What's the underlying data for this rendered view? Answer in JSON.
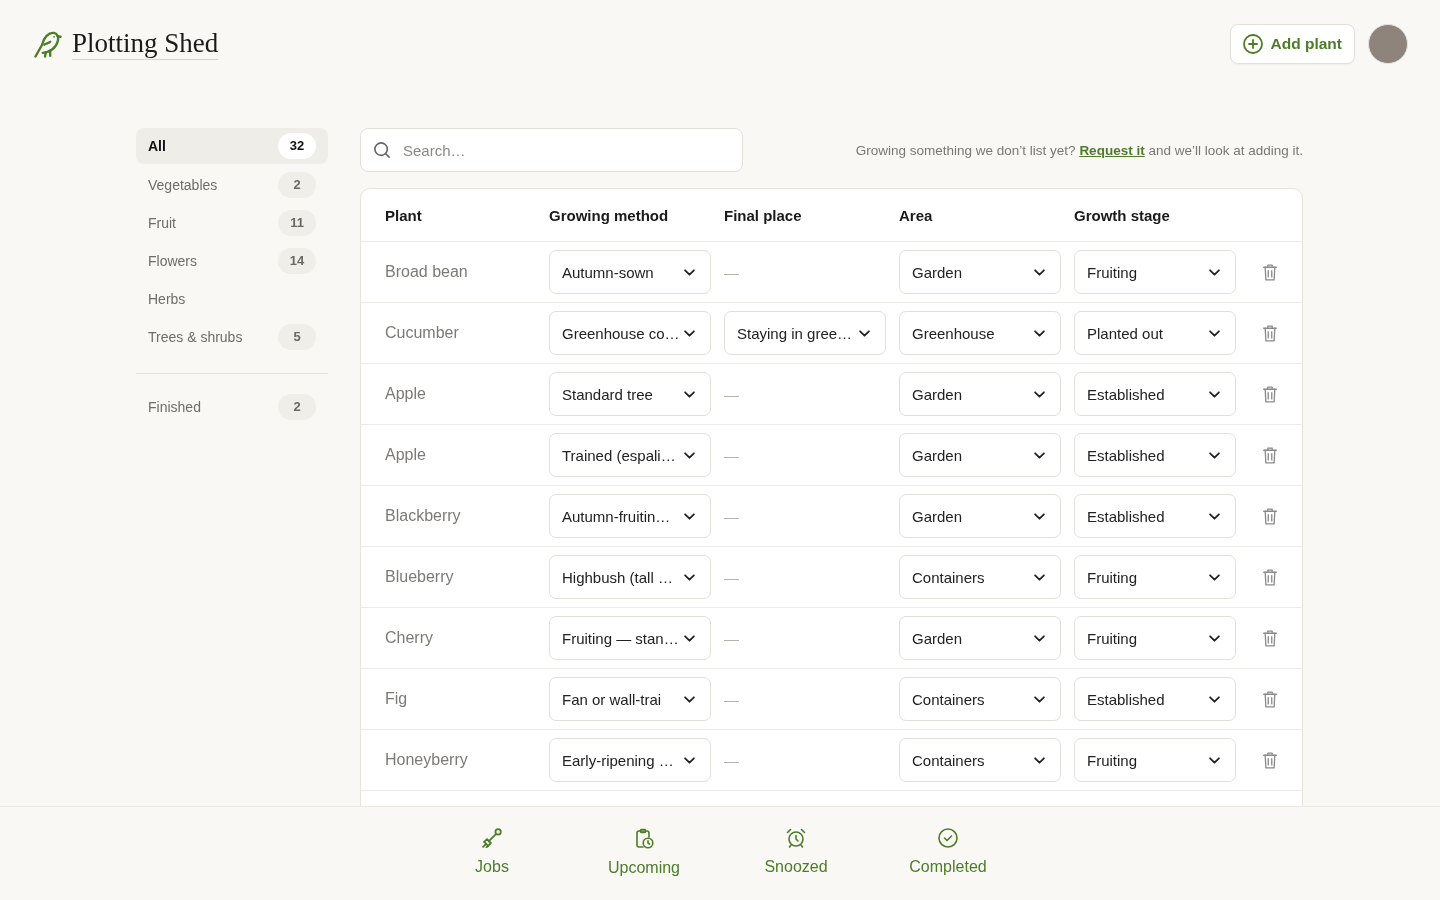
{
  "header": {
    "brand": "Plotting Shed",
    "add_button": "Add plant"
  },
  "sidebar": {
    "categories": [
      {
        "label": "All",
        "count": "32",
        "selected": true
      },
      {
        "label": "Vegetables",
        "count": "2",
        "selected": false
      },
      {
        "label": "Fruit",
        "count": "11",
        "selected": false
      },
      {
        "label": "Flowers",
        "count": "14",
        "selected": false
      },
      {
        "label": "Herbs",
        "selected": false
      },
      {
        "label": "Trees & shrubs",
        "count": "5",
        "selected": false
      }
    ],
    "archive": [
      {
        "label": "Finished",
        "count": "2",
        "selected": false
      }
    ]
  },
  "search": {
    "placeholder": "Search…"
  },
  "notice": {
    "before": "Growing something we don’t list yet?",
    "link": "Request it",
    "after": "and we’ll look at adding it."
  },
  "table": {
    "columns": [
      "Plant",
      "Growing method",
      "Final place",
      "Area",
      "Growth stage"
    ],
    "rows": [
      {
        "plant": "Broad bean",
        "growing_method": "Autumn-sown",
        "final_place": {
          "kind": "dash",
          "text": "—"
        },
        "area": "Garden",
        "growth_stage": "Fruiting"
      },
      {
        "plant": "Cucumber",
        "growing_method": "Greenhouse co…",
        "final_place": {
          "kind": "select",
          "text": "Staying in gree…"
        },
        "area": "Greenhouse",
        "growth_stage": "Planted out"
      },
      {
        "plant": "Apple",
        "growing_method": "Standard tree",
        "final_place": {
          "kind": "dash",
          "text": "—"
        },
        "area": "Garden",
        "growth_stage": "Established"
      },
      {
        "plant": "Apple",
        "growing_method": "Trained (espali…",
        "final_place": {
          "kind": "dash",
          "text": "—"
        },
        "area": "Garden",
        "growth_stage": "Established"
      },
      {
        "plant": "Blackberry",
        "growing_method": "Autumn-fruitin…",
        "final_place": {
          "kind": "dash",
          "text": "—"
        },
        "area": "Garden",
        "growth_stage": "Established"
      },
      {
        "plant": "Blueberry",
        "growing_method": "Highbush (tall …",
        "final_place": {
          "kind": "dash",
          "text": "—"
        },
        "area": "Containers",
        "growth_stage": "Fruiting"
      },
      {
        "plant": "Cherry",
        "growing_method": "Fruiting — stan…",
        "final_place": {
          "kind": "dash",
          "text": "—"
        },
        "area": "Garden",
        "growth_stage": "Fruiting"
      },
      {
        "plant": "Fig",
        "growing_method": "Fan or wall-trai",
        "final_place": {
          "kind": "dash",
          "text": "—"
        },
        "area": "Containers",
        "growth_stage": "Established"
      },
      {
        "plant": "Honeyberry",
        "growing_method": "Early-ripening …",
        "final_place": {
          "kind": "dash",
          "text": "—"
        },
        "area": "Containers",
        "growth_stage": "Fruiting"
      }
    ]
  },
  "bottom_nav": [
    {
      "label": "Jobs",
      "kind": "spade"
    },
    {
      "label": "Upcoming",
      "kind": "clipboard"
    },
    {
      "label": "Snoozed",
      "kind": "alarm"
    },
    {
      "label": "Completed",
      "kind": "check"
    }
  ]
}
